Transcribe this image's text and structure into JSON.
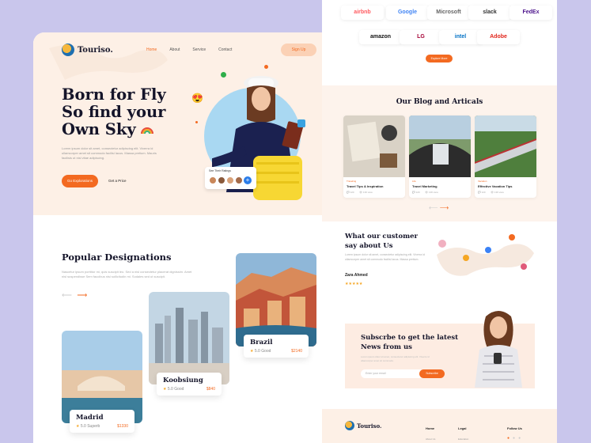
{
  "left": {
    "logo": "Touriso.",
    "nav": [
      "Home",
      "About",
      "Service",
      "Contact"
    ],
    "signup": "Sign Up",
    "hero_title_lines": [
      "Born for Fly",
      "So find your",
      "Own Sky"
    ],
    "hero_desc": "Lorem ipsum dolor sit amet, consectetur adipiscing elit. Viverra id ullamcorper amet sit commodo facilisi lacus. Massa pretium. Mauris facilisis ut nisl vitae adipiscing.",
    "btn_primary": "Go Explorations",
    "btn_link": "Get a Price",
    "ratings_title": "See Their Ratings",
    "popular_title": "Popular Designations",
    "popular_desc": "Nascetur ipsum porttitor mi, quis suscipit leo. Sed a nisl consectetur placerat dignissim. Amet nisl suspendisse Sem faucibus nisi sollicitudin mi. Sodales sed ut suscipit.",
    "destinations": [
      {
        "name": "Madrid",
        "rating": "5.0 Superb",
        "price": "$1330"
      },
      {
        "name": "Koobsiung",
        "rating": "5.0 Good",
        "price": "$840"
      },
      {
        "name": "Brazil",
        "rating": "5.0 Good",
        "price": "$2140"
      }
    ]
  },
  "right": {
    "brands": [
      "airbnb",
      "Google",
      "Microsoft",
      "slack",
      "FedEx",
      "amazon",
      "LG",
      "intel",
      "Adobe"
    ],
    "explore_btn": "Explore More",
    "blog_title": "Our Blog and Articals",
    "blogs": [
      {
        "category": "Traveling",
        "title": "Travel Tips & Inspiration",
        "views": "120",
        "comments": "136 view"
      },
      {
        "category": "Life",
        "title": "Travel Marketing",
        "views": "120",
        "comments": "136 view"
      },
      {
        "category": "Vacation",
        "title": "Effective Vacation Tips",
        "views": "120",
        "comments": "136 view"
      }
    ],
    "testimonial_title_lines": [
      "What our customer",
      "say about Us"
    ],
    "testimonial_desc": "Lorem ipsum dolor sit amet, consectetur adipiscing elit. Viverra id ullamcorper amet sit commodo facilisi lacus. Massa pretium.",
    "testimonial_name": "Zara Ahmed",
    "testimonial_stars": "★★★★★",
    "subscribe_title_lines": [
      "Subscrbe to get the latest",
      "News from us"
    ],
    "subscribe_desc": "Lorem ipsum dolor sit amet, consectetur adipiscing elit. Viverra id ullamcorper amet sit commodo.",
    "subscribe_placeholder": "Enter your email",
    "subscribe_btn": "Subscribe",
    "footer_logo": "Touriso.",
    "footer_cols": [
      "Home",
      "Legal",
      "Follow Us"
    ],
    "footer_subs": [
      "About Us",
      "Education"
    ]
  },
  "colors": {
    "accent": "#f36a21",
    "hero_bg": "#fdf0e6",
    "page_bg": "#c9c6ec",
    "star": "#f5a623"
  }
}
